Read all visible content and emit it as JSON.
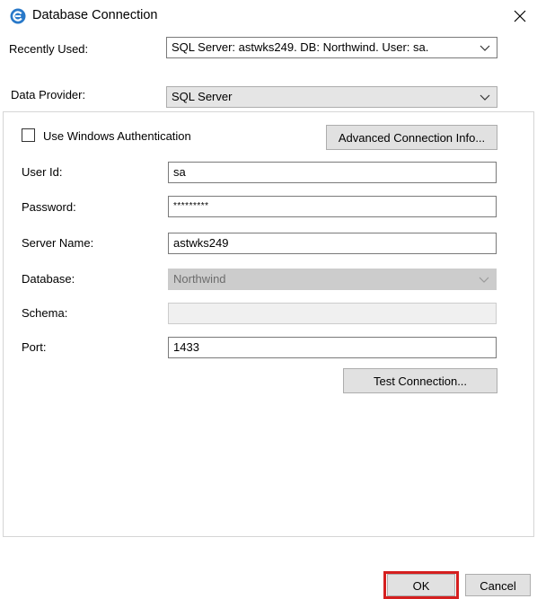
{
  "window": {
    "title": "Database Connection",
    "accent_color": "#2979c9",
    "highlight_color": "#d51f1f"
  },
  "recently_used": {
    "label": "Recently Used:",
    "value": "SQL Server:  astwks249. DB: Northwind. User: sa."
  },
  "data_provider": {
    "label": "Data Provider:",
    "value": "SQL Server"
  },
  "auth": {
    "use_windows_auth_label": "Use Windows Authentication",
    "checked": false,
    "advanced_button_label": "Advanced Connection Info..."
  },
  "fields": {
    "user_id": {
      "label": "User Id:",
      "value": "sa"
    },
    "password": {
      "label": "Password:",
      "value": "*********"
    },
    "server_name": {
      "label": "Server Name:",
      "value": "astwks249"
    },
    "database": {
      "label": "Database:",
      "value": "Northwind"
    },
    "schema": {
      "label": "Schema:",
      "value": ""
    },
    "port": {
      "label": "Port:",
      "value": "1433"
    }
  },
  "buttons": {
    "test_connection": "Test Connection...",
    "ok": "OK",
    "cancel": "Cancel"
  }
}
